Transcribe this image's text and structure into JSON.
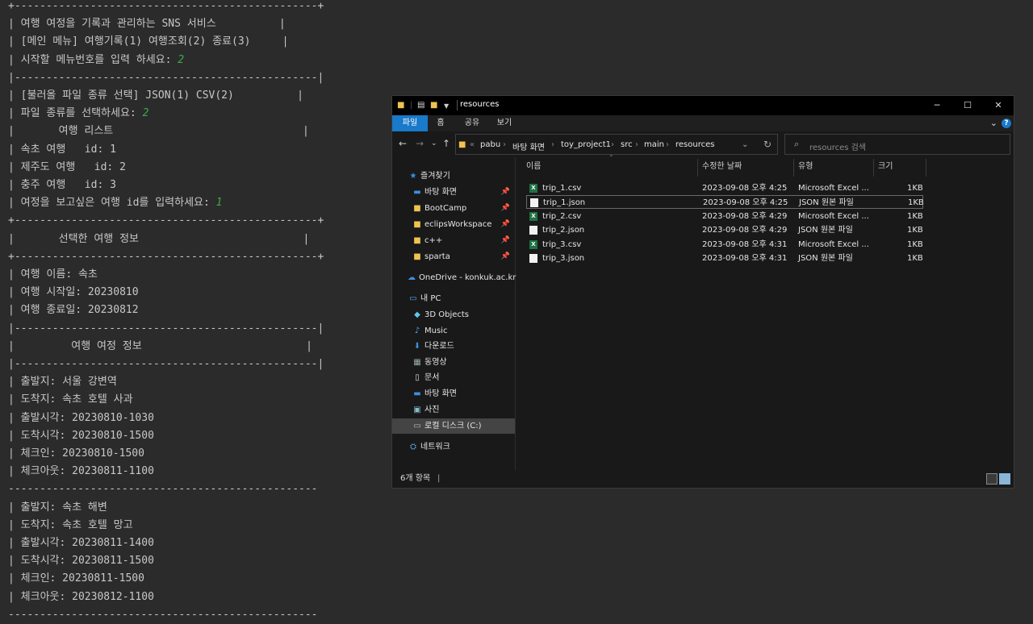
{
  "console": {
    "lines": [
      {
        "t": "+------------------------------------------------+"
      },
      {
        "t": "| 여행 여정을 기록과 관리하는 SNS 서비스          |"
      },
      {
        "t": "| [메인 메뉴] 여행기록(1) 여행조회(2) 종료(3)     |"
      },
      {
        "t": "| 시작할 메뉴번호를 입력 하세요: ",
        "input": "2"
      },
      {
        "t": "|------------------------------------------------|"
      },
      {
        "t": "| [불러올 파일 종류 선택] JSON(1) CSV(2)          |"
      },
      {
        "t": "| 파일 종류를 선택하세요: ",
        "input": "2"
      },
      {
        "t": "|       여행 리스트                              |"
      },
      {
        "t": "| 속초 여행   id: 1"
      },
      {
        "t": "| 제주도 여행   id: 2"
      },
      {
        "t": "| 충주 여행   id: 3"
      },
      {
        "t": "| 여정을 보고싶은 여행 id를 입력하세요: ",
        "input": "1"
      },
      {
        "t": "+------------------------------------------------+"
      },
      {
        "t": "|       선택한 여행 정보                          |"
      },
      {
        "t": "+------------------------------------------------+"
      },
      {
        "t": "| 여행 이름: 속초"
      },
      {
        "t": "| 여행 시작일: 20230810"
      },
      {
        "t": "| 여행 종료일: 20230812"
      },
      {
        "t": "|------------------------------------------------|"
      },
      {
        "t": "|         여행 여정 정보                          |"
      },
      {
        "t": "|------------------------------------------------|"
      },
      {
        "t": "| 출발지: 서울 강변역"
      },
      {
        "t": "| 도착지: 속초 호텔 사과"
      },
      {
        "t": "| 출발시각: 20230810-1030"
      },
      {
        "t": "| 도착시각: 20230810-1500"
      },
      {
        "t": "| 체크인: 20230810-1500"
      },
      {
        "t": "| 체크아웃: 20230811-1100"
      },
      {
        "t": "-------------------------------------------------"
      },
      {
        "t": "| 출발지: 속초 해변"
      },
      {
        "t": "| 도착지: 속초 호텔 망고"
      },
      {
        "t": "| 출발시각: 20230811-1400"
      },
      {
        "t": "| 도착시각: 20230811-1500"
      },
      {
        "t": "| 체크인: 20230811-1500"
      },
      {
        "t": "| 체크아웃: 20230812-1100"
      },
      {
        "t": "-------------------------------------------------"
      }
    ],
    "input_color": "#3fa848"
  },
  "explorer": {
    "title": "resources",
    "ribbon_tabs": [
      "파일",
      "홈",
      "공유",
      "보기"
    ],
    "address": [
      "pabu",
      "바탕 화면",
      "toy_project1",
      "src",
      "main",
      "resources"
    ],
    "search_placeholder": "resources 검색",
    "nav": {
      "quick_access": "즐겨찾기",
      "pinned": [
        "바탕 화면",
        "BootCamp",
        "eclipsWorkspace",
        "c++",
        "sparta"
      ],
      "onedrive": "OneDrive - konkuk.ac.kr",
      "this_pc": "내 PC",
      "pc_items": [
        "3D Objects",
        "Music",
        "다운로드",
        "동영상",
        "문서",
        "바탕 화면",
        "사진",
        "로컬 디스크 (C:)"
      ],
      "network": "네트워크"
    },
    "columns": [
      "이름",
      "수정한 날짜",
      "유형",
      "크기"
    ],
    "files": [
      {
        "name": "trip_1.csv",
        "date": "2023-09-08 오후 4:25",
        "type": "Microsoft Excel ...",
        "size": "1KB",
        "kind": "csv"
      },
      {
        "name": "trip_1.json",
        "date": "2023-09-08 오후 4:25",
        "type": "JSON 원본 파일",
        "size": "1KB",
        "kind": "json"
      },
      {
        "name": "trip_2.csv",
        "date": "2023-09-08 오후 4:29",
        "type": "Microsoft Excel ...",
        "size": "1KB",
        "kind": "csv"
      },
      {
        "name": "trip_2.json",
        "date": "2023-09-08 오후 4:29",
        "type": "JSON 원본 파일",
        "size": "1KB",
        "kind": "json"
      },
      {
        "name": "trip_3.csv",
        "date": "2023-09-08 오후 4:31",
        "type": "Microsoft Excel ...",
        "size": "1KB",
        "kind": "csv"
      },
      {
        "name": "trip_3.json",
        "date": "2023-09-08 오후 4:31",
        "type": "JSON 원본 파일",
        "size": "1KB",
        "kind": "json"
      }
    ],
    "status": "6개 항목",
    "accent": "#1979ca"
  }
}
